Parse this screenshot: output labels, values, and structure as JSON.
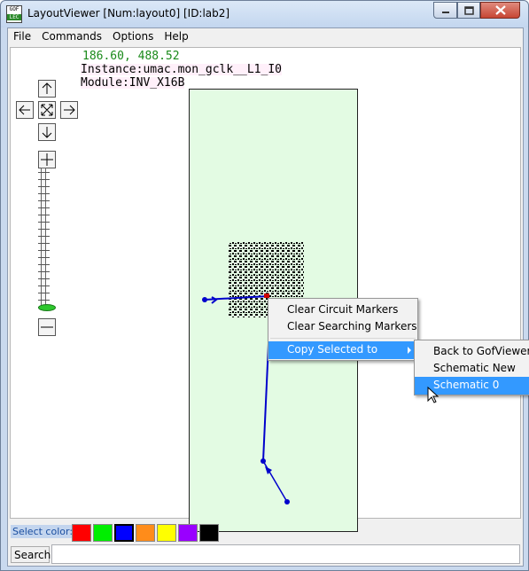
{
  "window": {
    "title": "LayoutViewer [Num:layout0] [ID:lab2]",
    "app_icon_label": "GOF",
    "app_icon_sub": "LEC"
  },
  "menubar": {
    "items": [
      "File",
      "Commands",
      "Options",
      "Help"
    ]
  },
  "navigation": {
    "icons": [
      "up-arrow-icon",
      "left-arrow-icon",
      "fit-view-icon",
      "right-arrow-icon",
      "down-arrow-icon",
      "zoom-in-icon",
      "zoom-out-icon"
    ],
    "zoom_level_fraction": 0.02
  },
  "layout_view": {
    "coordinates": "186.60, 488.52",
    "instance_label": "Instance:umac.mon_gclk__L1_I0",
    "module_label": "Module:INV_X16B",
    "background_color": "#e3fbe3",
    "wire_color": "#0000cc"
  },
  "context_menu": {
    "items": [
      {
        "label": "Clear Circuit Markers",
        "selected": false,
        "submenu": false
      },
      {
        "label": "Clear Searching Markers",
        "selected": false,
        "submenu": false
      },
      {
        "label": "Copy Selected to",
        "selected": true,
        "submenu": true
      }
    ]
  },
  "submenu": {
    "items": [
      {
        "label": "Back to GofViewer",
        "selected": false
      },
      {
        "label": "Schematic New",
        "selected": false
      },
      {
        "label": "Schematic 0",
        "selected": true
      }
    ]
  },
  "color_bar": {
    "label": "Select color:",
    "swatches": [
      "#ff0000",
      "#00ee00",
      "#0000ff",
      "#ff8c1a",
      "#ffff00",
      "#9900ff",
      "#000000"
    ],
    "active_index": 2
  },
  "search": {
    "label": "Search:",
    "value": "",
    "placeholder": ""
  }
}
